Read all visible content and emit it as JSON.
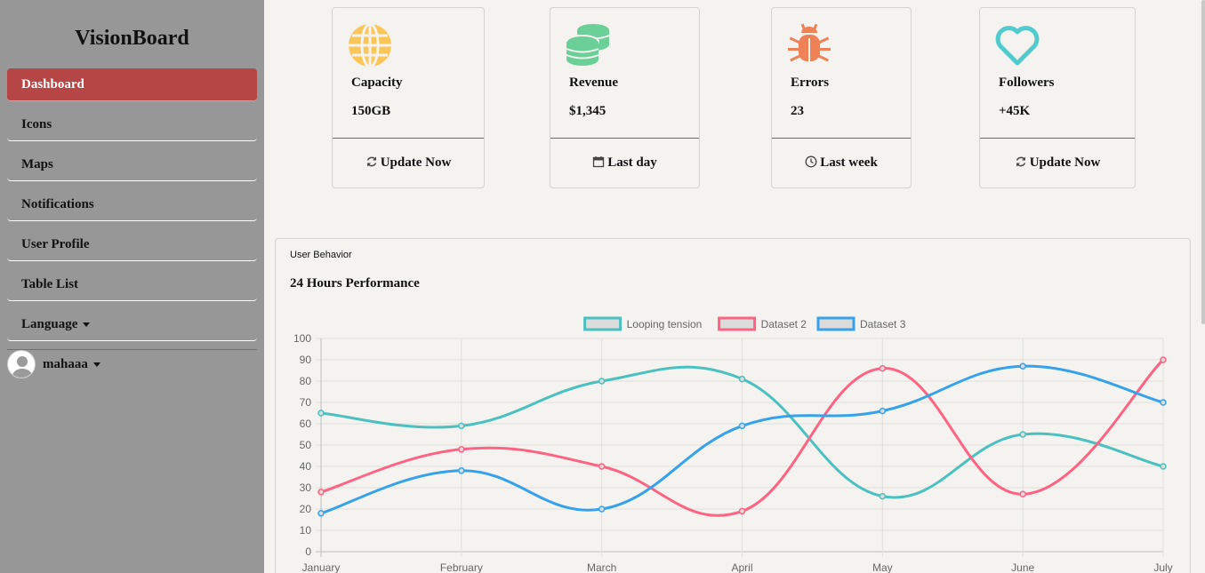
{
  "sidebar": {
    "brand": "VisionBoard",
    "items": [
      {
        "label": "Dashboard",
        "active": true
      },
      {
        "label": "Icons"
      },
      {
        "label": "Maps"
      },
      {
        "label": "Notifications"
      },
      {
        "label": "User Profile"
      },
      {
        "label": "Table List"
      },
      {
        "label": "Language"
      }
    ],
    "user": "mahaaa"
  },
  "cards": [
    {
      "title": "Capacity",
      "value": "150GB",
      "footer": "Update Now",
      "icon": "globe-icon",
      "color": "#fbc658"
    },
    {
      "title": "Revenue",
      "value": "$1,345",
      "footer": "Last day",
      "icon": "money-coins-icon",
      "color": "#6bd098"
    },
    {
      "title": "Errors",
      "value": "23",
      "footer": "Last week",
      "icon": "bug-icon",
      "color": "#ef8157"
    },
    {
      "title": "Followers",
      "value": "+45K",
      "footer": "Update Now",
      "icon": "heart-icon",
      "color": "#51cbce"
    }
  ],
  "chart_section": {
    "subtitle": "User Behavior",
    "title": "24 Hours Performance"
  },
  "chart_data": {
    "type": "line",
    "categories": [
      "January",
      "February",
      "March",
      "April",
      "May",
      "June",
      "July"
    ],
    "ylim": [
      0,
      100
    ],
    "yticks": [
      "0",
      "10",
      "20",
      "30",
      "40",
      "50",
      "60",
      "70",
      "80",
      "90",
      "100"
    ],
    "grid": true,
    "legend_position": "top",
    "series": [
      {
        "name": "Looping tension",
        "color": "#4bc0c0",
        "values": [
          65,
          59,
          80,
          81,
          26,
          55,
          40
        ]
      },
      {
        "name": "Dataset 2",
        "color": "#ff6384",
        "values": [
          28,
          48,
          40,
          19,
          86,
          27,
          90
        ]
      },
      {
        "name": "Dataset 3",
        "color": "#36a2eb",
        "values": [
          18,
          38,
          20,
          59,
          66,
          87,
          70
        ]
      }
    ]
  }
}
